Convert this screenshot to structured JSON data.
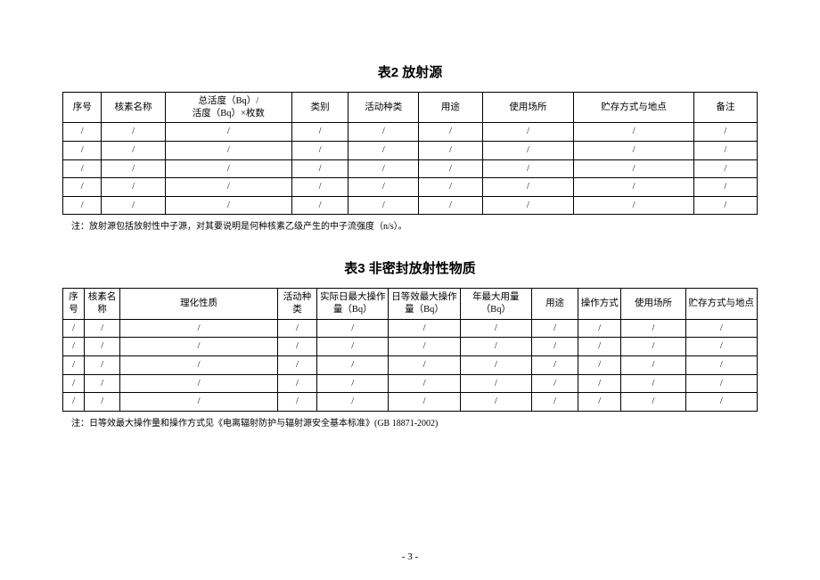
{
  "table1": {
    "title": "表2  放射源",
    "headers": [
      "序号",
      "核素名称",
      "总活度（Bq）/\n活度（Bq）×枚数",
      "类别",
      "活动种类",
      "用途",
      "使用场所",
      "贮存方式与地点",
      "备注"
    ],
    "rows": [
      [
        "/",
        "/",
        "/",
        "/",
        "/",
        "/",
        "/",
        "/",
        "/"
      ],
      [
        "/",
        "/",
        "/",
        "/",
        "/",
        "/",
        "/",
        "/",
        "/"
      ],
      [
        "/",
        "/",
        "/",
        "/",
        "/",
        "/",
        "/",
        "/",
        "/"
      ],
      [
        "/",
        "/",
        "/",
        "/",
        "/",
        "/",
        "/",
        "/",
        "/"
      ],
      [
        "/",
        "/",
        "/",
        "/",
        "/",
        "/",
        "/",
        "/",
        "/"
      ]
    ],
    "note": "注：放射源包括放射性中子源，对其要说明是何种核素乙级产生的中子流强度（n/s）。"
  },
  "table2": {
    "title": "表3  非密封放射性物质",
    "headers": [
      "序号",
      "核素名称",
      "理化性质",
      "活动种类",
      "实际日最大操作量（Bq）",
      "日等效最大操作量（Bq）",
      "年最大用量（Bq）",
      "用途",
      "操作方式",
      "使用场所",
      "贮存方式与地点"
    ],
    "rows": [
      [
        "/",
        "/",
        "/",
        "/",
        "/",
        "/",
        "/",
        "/",
        "/",
        "/",
        "/"
      ],
      [
        "/",
        "/",
        "/",
        "/",
        "/",
        "/",
        "/",
        "/",
        "/",
        "/",
        "/"
      ],
      [
        "/",
        "/",
        "/",
        "/",
        "/",
        "/",
        "/",
        "/",
        "/",
        "/",
        "/"
      ],
      [
        "/",
        "/",
        "/",
        "/",
        "/",
        "/",
        "/",
        "/",
        "/",
        "/",
        "/"
      ],
      [
        "/",
        "/",
        "/",
        "/",
        "/",
        "/",
        "/",
        "/",
        "/",
        "/",
        "/"
      ]
    ],
    "note": "注：日等效最大操作量和操作方式见《电离辐射防护与辐射源安全基本标准》(GB 18871-2002)"
  },
  "page_number": "- 3 -"
}
